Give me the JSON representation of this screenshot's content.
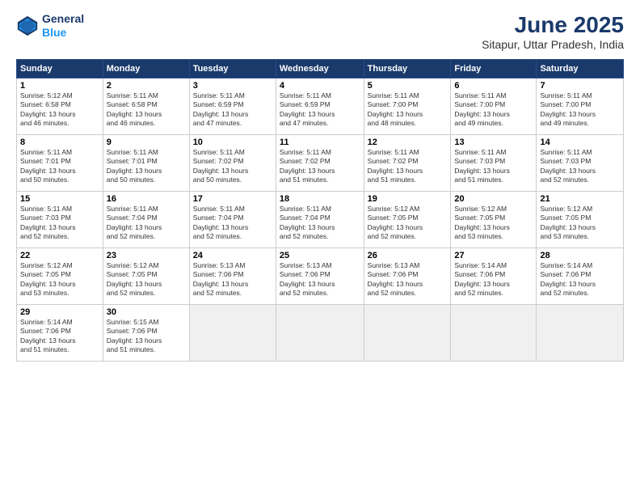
{
  "header": {
    "logo_line1": "General",
    "logo_line2": "Blue",
    "month_year": "June 2025",
    "location": "Sitapur, Uttar Pradesh, India"
  },
  "weekdays": [
    "Sunday",
    "Monday",
    "Tuesday",
    "Wednesday",
    "Thursday",
    "Friday",
    "Saturday"
  ],
  "rows": [
    [
      {
        "day": "1",
        "lines": [
          "Sunrise: 5:12 AM",
          "Sunset: 6:58 PM",
          "Daylight: 13 hours",
          "and 46 minutes."
        ]
      },
      {
        "day": "2",
        "lines": [
          "Sunrise: 5:11 AM",
          "Sunset: 6:58 PM",
          "Daylight: 13 hours",
          "and 46 minutes."
        ]
      },
      {
        "day": "3",
        "lines": [
          "Sunrise: 5:11 AM",
          "Sunset: 6:59 PM",
          "Daylight: 13 hours",
          "and 47 minutes."
        ]
      },
      {
        "day": "4",
        "lines": [
          "Sunrise: 5:11 AM",
          "Sunset: 6:59 PM",
          "Daylight: 13 hours",
          "and 47 minutes."
        ]
      },
      {
        "day": "5",
        "lines": [
          "Sunrise: 5:11 AM",
          "Sunset: 7:00 PM",
          "Daylight: 13 hours",
          "and 48 minutes."
        ]
      },
      {
        "day": "6",
        "lines": [
          "Sunrise: 5:11 AM",
          "Sunset: 7:00 PM",
          "Daylight: 13 hours",
          "and 49 minutes."
        ]
      },
      {
        "day": "7",
        "lines": [
          "Sunrise: 5:11 AM",
          "Sunset: 7:00 PM",
          "Daylight: 13 hours",
          "and 49 minutes."
        ]
      }
    ],
    [
      {
        "day": "8",
        "lines": [
          "Sunrise: 5:11 AM",
          "Sunset: 7:01 PM",
          "Daylight: 13 hours",
          "and 50 minutes."
        ]
      },
      {
        "day": "9",
        "lines": [
          "Sunrise: 5:11 AM",
          "Sunset: 7:01 PM",
          "Daylight: 13 hours",
          "and 50 minutes."
        ]
      },
      {
        "day": "10",
        "lines": [
          "Sunrise: 5:11 AM",
          "Sunset: 7:02 PM",
          "Daylight: 13 hours",
          "and 50 minutes."
        ]
      },
      {
        "day": "11",
        "lines": [
          "Sunrise: 5:11 AM",
          "Sunset: 7:02 PM",
          "Daylight: 13 hours",
          "and 51 minutes."
        ]
      },
      {
        "day": "12",
        "lines": [
          "Sunrise: 5:11 AM",
          "Sunset: 7:02 PM",
          "Daylight: 13 hours",
          "and 51 minutes."
        ]
      },
      {
        "day": "13",
        "lines": [
          "Sunrise: 5:11 AM",
          "Sunset: 7:03 PM",
          "Daylight: 13 hours",
          "and 51 minutes."
        ]
      },
      {
        "day": "14",
        "lines": [
          "Sunrise: 5:11 AM",
          "Sunset: 7:03 PM",
          "Daylight: 13 hours",
          "and 52 minutes."
        ]
      }
    ],
    [
      {
        "day": "15",
        "lines": [
          "Sunrise: 5:11 AM",
          "Sunset: 7:03 PM",
          "Daylight: 13 hours",
          "and 52 minutes."
        ]
      },
      {
        "day": "16",
        "lines": [
          "Sunrise: 5:11 AM",
          "Sunset: 7:04 PM",
          "Daylight: 13 hours",
          "and 52 minutes."
        ]
      },
      {
        "day": "17",
        "lines": [
          "Sunrise: 5:11 AM",
          "Sunset: 7:04 PM",
          "Daylight: 13 hours",
          "and 52 minutes."
        ]
      },
      {
        "day": "18",
        "lines": [
          "Sunrise: 5:11 AM",
          "Sunset: 7:04 PM",
          "Daylight: 13 hours",
          "and 52 minutes."
        ]
      },
      {
        "day": "19",
        "lines": [
          "Sunrise: 5:12 AM",
          "Sunset: 7:05 PM",
          "Daylight: 13 hours",
          "and 52 minutes."
        ]
      },
      {
        "day": "20",
        "lines": [
          "Sunrise: 5:12 AM",
          "Sunset: 7:05 PM",
          "Daylight: 13 hours",
          "and 53 minutes."
        ]
      },
      {
        "day": "21",
        "lines": [
          "Sunrise: 5:12 AM",
          "Sunset: 7:05 PM",
          "Daylight: 13 hours",
          "and 53 minutes."
        ]
      }
    ],
    [
      {
        "day": "22",
        "lines": [
          "Sunrise: 5:12 AM",
          "Sunset: 7:05 PM",
          "Daylight: 13 hours",
          "and 53 minutes."
        ]
      },
      {
        "day": "23",
        "lines": [
          "Sunrise: 5:12 AM",
          "Sunset: 7:05 PM",
          "Daylight: 13 hours",
          "and 52 minutes."
        ]
      },
      {
        "day": "24",
        "lines": [
          "Sunrise: 5:13 AM",
          "Sunset: 7:06 PM",
          "Daylight: 13 hours",
          "and 52 minutes."
        ]
      },
      {
        "day": "25",
        "lines": [
          "Sunrise: 5:13 AM",
          "Sunset: 7:06 PM",
          "Daylight: 13 hours",
          "and 52 minutes."
        ]
      },
      {
        "day": "26",
        "lines": [
          "Sunrise: 5:13 AM",
          "Sunset: 7:06 PM",
          "Daylight: 13 hours",
          "and 52 minutes."
        ]
      },
      {
        "day": "27",
        "lines": [
          "Sunrise: 5:14 AM",
          "Sunset: 7:06 PM",
          "Daylight: 13 hours",
          "and 52 minutes."
        ]
      },
      {
        "day": "28",
        "lines": [
          "Sunrise: 5:14 AM",
          "Sunset: 7:06 PM",
          "Daylight: 13 hours",
          "and 52 minutes."
        ]
      }
    ],
    [
      {
        "day": "29",
        "lines": [
          "Sunrise: 5:14 AM",
          "Sunset: 7:06 PM",
          "Daylight: 13 hours",
          "and 51 minutes."
        ]
      },
      {
        "day": "30",
        "lines": [
          "Sunrise: 5:15 AM",
          "Sunset: 7:06 PM",
          "Daylight: 13 hours",
          "and 51 minutes."
        ]
      },
      null,
      null,
      null,
      null,
      null
    ]
  ]
}
